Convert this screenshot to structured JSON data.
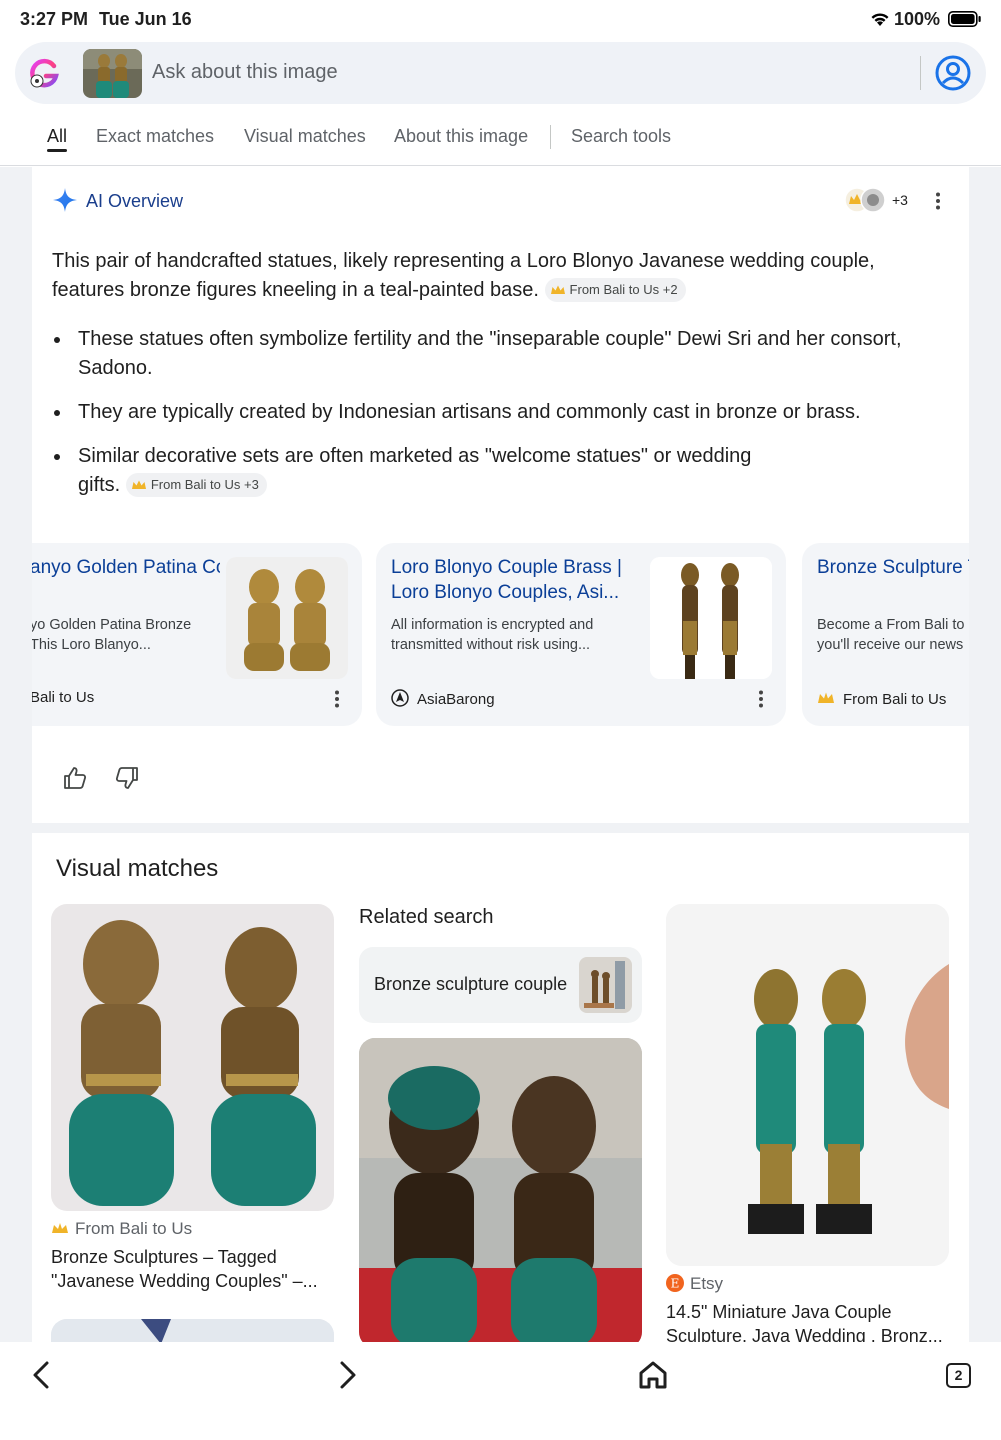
{
  "status_bar": {
    "time": "3:27 PM",
    "date": "Tue Jun 16",
    "battery": "100%"
  },
  "search": {
    "query_placeholder": "Ask about this image"
  },
  "tabs": [
    {
      "label": "All",
      "active": true
    },
    {
      "label": "Exact matches"
    },
    {
      "label": "Visual matches"
    },
    {
      "label": "About this image"
    },
    {
      "label": "Search tools"
    }
  ],
  "ai_overview": {
    "title": "AI Overview",
    "sources_more": "+3",
    "summary": "This pair of handcrafted statues, likely representing a Loro Blonyo Javanese wedding couple, features bronze figures kneeling in a teal-painted base.",
    "summary_chip": "From Bali to Us +2",
    "bullets": [
      {
        "text": "These statues often symbolize fertility and the \"inseparable couple\" Dewi Sri and her consort, Sadono."
      },
      {
        "text": "They are typically created by Indonesian artisans and commonly cast in bronze or brass."
      },
      {
        "text": "Similar decorative sets are often marketed as \"welcome statues\" or wedding gifts.",
        "chip": "From Bali to Us +3"
      }
    ],
    "source_cards": [
      {
        "title": "anyo Golden Patina Couple – From Ba...",
        "desc": "yo Golden Patina Bronze This Loro Blanyo...",
        "site": "Bali to Us"
      },
      {
        "title": "Loro Blonyo Couple Brass | Loro Blonyo Couples, Asi...",
        "desc": "All information is encrypted and transmitted without risk using...",
        "site": "AsiaBarong"
      },
      {
        "title": "Bronze Sculpture Tagged \"Javanes",
        "desc": "Become a From Bali to you'll receive our news",
        "site": "From Bali to Us"
      }
    ]
  },
  "visual_matches": {
    "title": "Visual matches",
    "related_title": "Related search",
    "related_chip": "Bronze sculpture couple",
    "items": [
      {
        "source": "From Bali to Us",
        "caption": "Bronze Sculptures – Tagged \"Javanese Wedding Couples\" –..."
      },
      {
        "source": "Etsy",
        "caption": "14.5\" Miniature Java Couple Sculpture, Java Wedding , Bronz..."
      }
    ]
  },
  "bottom_nav": {
    "tab_count": "2"
  },
  "colors": {
    "accent_blue": "#1a73e8",
    "link_blue": "#0b3f97",
    "teal_base": "#1f8a7a",
    "bronze": "#8a6a2c"
  }
}
